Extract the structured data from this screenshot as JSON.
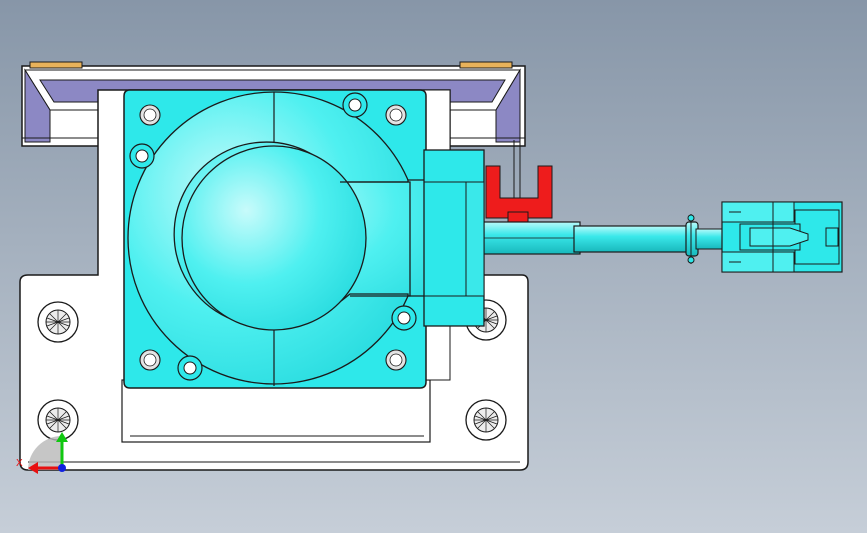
{
  "viewport": {
    "background_top": "#8796a8",
    "background_bottom": "#c6ced8"
  },
  "model": {
    "components": [
      {
        "name": "top-bracket",
        "color": "#ffffff"
      },
      {
        "name": "mounting-rail",
        "color": "#8c88c4"
      },
      {
        "name": "base-plate",
        "color": "#ffffff"
      },
      {
        "name": "motor-body",
        "color": "#2ee8ea"
      },
      {
        "name": "stop-clip",
        "color": "#ee1c1c"
      },
      {
        "name": "cable-shaft",
        "color": "#2ee8ea"
      },
      {
        "name": "connector",
        "color": "#2ee8ea"
      },
      {
        "name": "tab-pads",
        "color": "#e8b25a"
      }
    ],
    "outline_color": "#1a1a1a"
  },
  "triad": {
    "x_color": "#e81010",
    "y_color": "#10c810",
    "z_color": "#1020e0",
    "x_label": "X"
  }
}
